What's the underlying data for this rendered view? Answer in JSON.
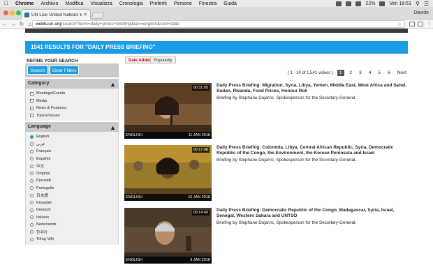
{
  "menubar": {
    "app": "Chrome",
    "items": [
      "Archivio",
      "Modifica",
      "Visualizza",
      "Cronologia",
      "Preferiti",
      "Persone",
      "Finestra",
      "Guida"
    ],
    "battery": "22%",
    "clock": "Ven 18:51"
  },
  "browser": {
    "tab_title": "UN Live United Nations Web",
    "profile": "Davide",
    "url_host": "webtv.un.org",
    "url_rest": "/search?term=daily+press+briefing&lan=english&sort=date"
  },
  "search": {
    "results_heading": "1541 RESULTS FOR \"DAILY PRESS BRIEFING\"",
    "sort_tabs": [
      "Date Added",
      "Popularity"
    ]
  },
  "sidebar": {
    "refine_title": "REFINE YOUR SEARCH",
    "search_button": "Search",
    "clear_button": "Clear Filters",
    "category_title": "Category",
    "categories": [
      "Meetings/Events",
      "Media",
      "News & Features",
      "Topics/Issues"
    ],
    "language_title": "Language",
    "languages": [
      "English",
      "عربي",
      "Français",
      "Español",
      "中文",
      "Original",
      "Русский",
      "Português",
      "日本語",
      "Kiswahili",
      "Deutsch",
      "Italiano",
      "Nederlands",
      "한국어",
      "Tiếng Việt"
    ],
    "selected_language": "English"
  },
  "pagination": {
    "range": "( 1 - 10 of 1,541 videos )",
    "pages": [
      "1",
      "2",
      "3",
      "4",
      "5",
      "6"
    ],
    "current": "1",
    "next": "Next"
  },
  "results": [
    {
      "duration": "00:31:05",
      "language": "ENGLISH",
      "date": "11 JAN 2018",
      "title": "Daily Press Briefing: Migration, Syria, Libya, Yemen, Middle East, West Africa and Sahel, Sudan, Rwanda, Food Prices, Honour Roll",
      "desc": "Briefing by Stephane Dujarric, Spokesperson for the Secretary-General."
    },
    {
      "duration": "00:17:48",
      "language": "ENGLISH",
      "date": "10 JAN 2018",
      "title": "Daily Press Briefing: Colombia, Libya, Central African Republic, Syria, Democratic Republic of the Congo, the Environment, the Korean Peninsula and Israel",
      "desc": "Briefing by Stephane Dujarric, Spokesperson for the Secretary-General."
    },
    {
      "duration": "00:14:40",
      "language": "ENGLISH",
      "date": "9 JAN 2018",
      "title": "Daily Press Briefing: Democratic Republic of the Congo, Madagascar, Syria, Israel, Senegal, Western Sahara and UNTSO",
      "desc": "Briefing by Stephane Dujarric, Spokesperson for the Secretary-General."
    }
  ],
  "colors": {
    "accent": "#1b9de5",
    "active_sort": "#d0021b"
  }
}
